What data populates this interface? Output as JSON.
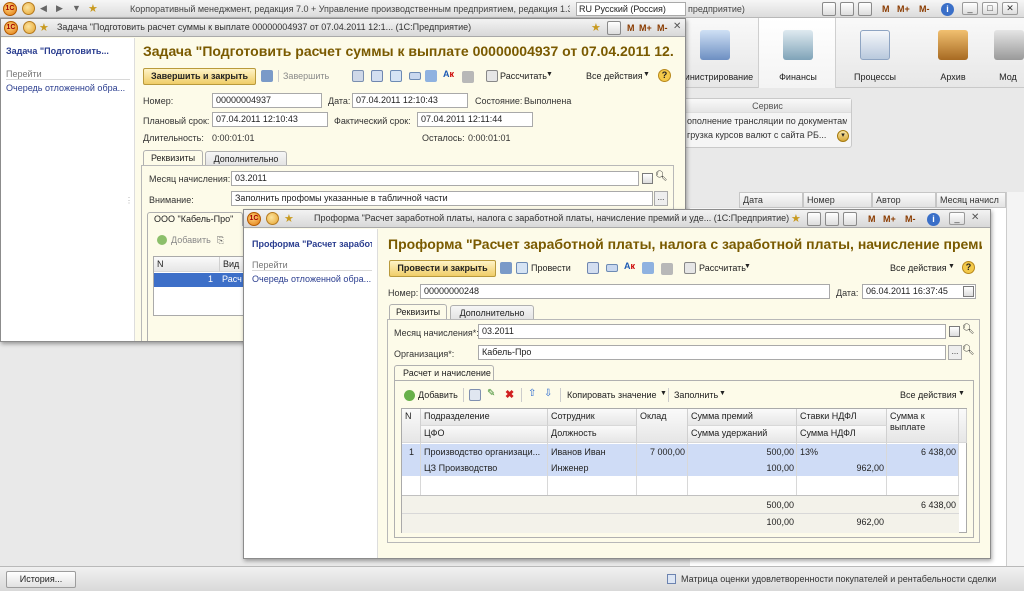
{
  "main_window": {
    "title": "Корпоративный менеджмент, редакция 7.0 + Управление производственным предприятием, редакция 1.3",
    "language": "RU Русский (Россия)",
    "title_suffix": "предприятие)",
    "m_buttons": [
      "M",
      "M+",
      "M-"
    ],
    "sections": [
      {
        "label": "инистрирование"
      },
      {
        "label": "Финансы"
      },
      {
        "label": "Процессы"
      },
      {
        "label": "Архив"
      },
      {
        "label": "Мод"
      }
    ],
    "service": {
      "header": "Сервис",
      "items": [
        "ополнение трансляции по документам",
        "грузка курсов валют с сайта РБ..."
      ]
    },
    "list_columns": [
      "Дата",
      "Номер",
      "Автор",
      "Месяц начисл"
    ],
    "history_button": "История...",
    "status_text": "Матрица оценки удовлетворенности покупателей и рентабельности сделки"
  },
  "task_window": {
    "title": "Задача \"Подготовить расчет суммы к выплате  00000004937 от 07.04.2011 12:1...  (1С:Предприятие)",
    "nav": {
      "heading": "Задача \"Подготовить...",
      "goto": "Перейти",
      "link": "Очередь отложенной обра..."
    },
    "form_title": "Задача \"Подготовить расчет суммы к выплате  00000004937 от 07.04.2011 12...",
    "toolbar": {
      "finish_close": "Завершить и закрыть",
      "finish": "Завершить",
      "calculate": "Рассчитать",
      "all_actions": "Все действия"
    },
    "fields": {
      "number_label": "Номер:",
      "number": "00000004937",
      "date_label": "Дата:",
      "date": "07.04.2011 12:10:43",
      "state_label": "Состояние:",
      "state": "Выполнена",
      "planned_label": "Плановый срок:",
      "planned": "07.04.2011 12:10:43",
      "actual_label": "Фактический срок:",
      "actual": "07.04.2011 12:11:44",
      "duration_label": "Длительность:",
      "duration": "0:00:01:01",
      "remaining_label": "Осталось:",
      "remaining": "0:00:01:01"
    },
    "tabs": [
      "Реквизиты",
      "Дополнительно"
    ],
    "month_label": "Месяц начисления:",
    "month": "03.2011",
    "attention_label": "Внимание:",
    "attention": "Заполнить профомы указанные в табличной части",
    "org_tab": "ООО \"Кабель-Про\"",
    "add_label": "Добавить",
    "grid_headers": [
      "N",
      "Вид"
    ],
    "grid_row": {
      "n": "1",
      "kind": "Расч"
    }
  },
  "proforma_window": {
    "title": "Проформа \"Расчет заработной платы, налога с заработной платы, начисление премий и уде...  (1С:Предприятие)",
    "nav": {
      "heading": "Проформа \"Расчет заработной...",
      "goto": "Перейти",
      "link": "Очередь отложенной обра..."
    },
    "form_title": "Проформа \"Расчет заработной платы, налога с заработной платы, начисление премий...",
    "toolbar": {
      "post_close": "Провести и закрыть",
      "post": "Провести",
      "calculate": "Рассчитать",
      "all_actions": "Все действия"
    },
    "number_label": "Номер:",
    "number": "00000000248",
    "date_label": "Дата:",
    "date": "06.04.2011 16:37:45",
    "tabs": [
      "Реквизиты",
      "Дополнительно"
    ],
    "month_label": "Месяц начисления*:",
    "month": "03.2011",
    "org_label": "Организация*:",
    "org": "Кабель-Про",
    "inner_tab": "Расчет и начисление",
    "inner_toolbar": {
      "add": "Добавить",
      "copy_value": "Копировать значение",
      "fill": "Заполнить",
      "all_actions": "Все действия"
    },
    "grid": {
      "headers_top": [
        "N",
        "Подразделение",
        "Сотрудник",
        "Оклад",
        "Сумма премий",
        "Ставки НДФЛ",
        "Сумма к выплате"
      ],
      "headers_bottom": [
        "ЦФО",
        "Должность",
        "Сумма удержаний",
        "Сумма НДФЛ"
      ],
      "row": {
        "n": "1",
        "department": "Производство организаци...",
        "employee": "Иванов Иван",
        "salary": "7 000,00",
        "bonus": "500,00",
        "ndfl_rate": "13%",
        "payout": "6 438,00",
        "cfo": "ЦЗ Производство",
        "position": "Инженер",
        "deductions": "100,00",
        "ndfl_sum": "962,00"
      },
      "totals": {
        "bonus": "500,00",
        "payout": "6 438,00",
        "deductions": "100,00",
        "ndfl_sum": "962,00"
      }
    }
  }
}
